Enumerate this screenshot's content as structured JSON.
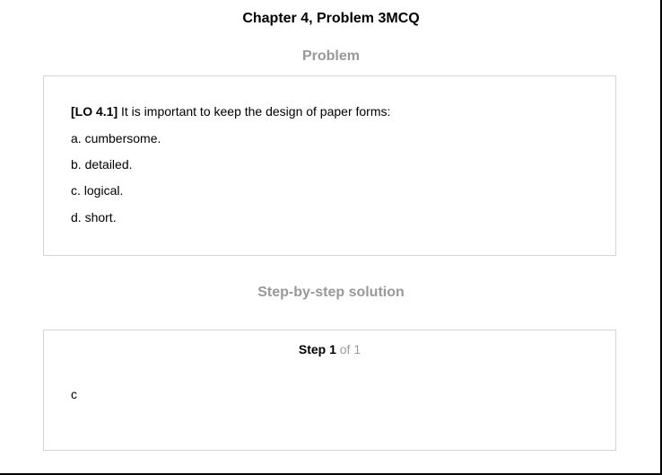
{
  "page": {
    "chapter_title": "Chapter 4, Problem 3MCQ"
  },
  "problem": {
    "heading": "Problem",
    "lo_tag": "[LO 4.1]",
    "question": " It is important to keep the design of paper forms:",
    "options": [
      "a. cumbersome.",
      "b. detailed.",
      "c. logical.",
      "d. short."
    ]
  },
  "solution": {
    "heading": "Step-by-step solution",
    "step_label": "Step 1",
    "step_of": " of 1",
    "answer": "c"
  }
}
